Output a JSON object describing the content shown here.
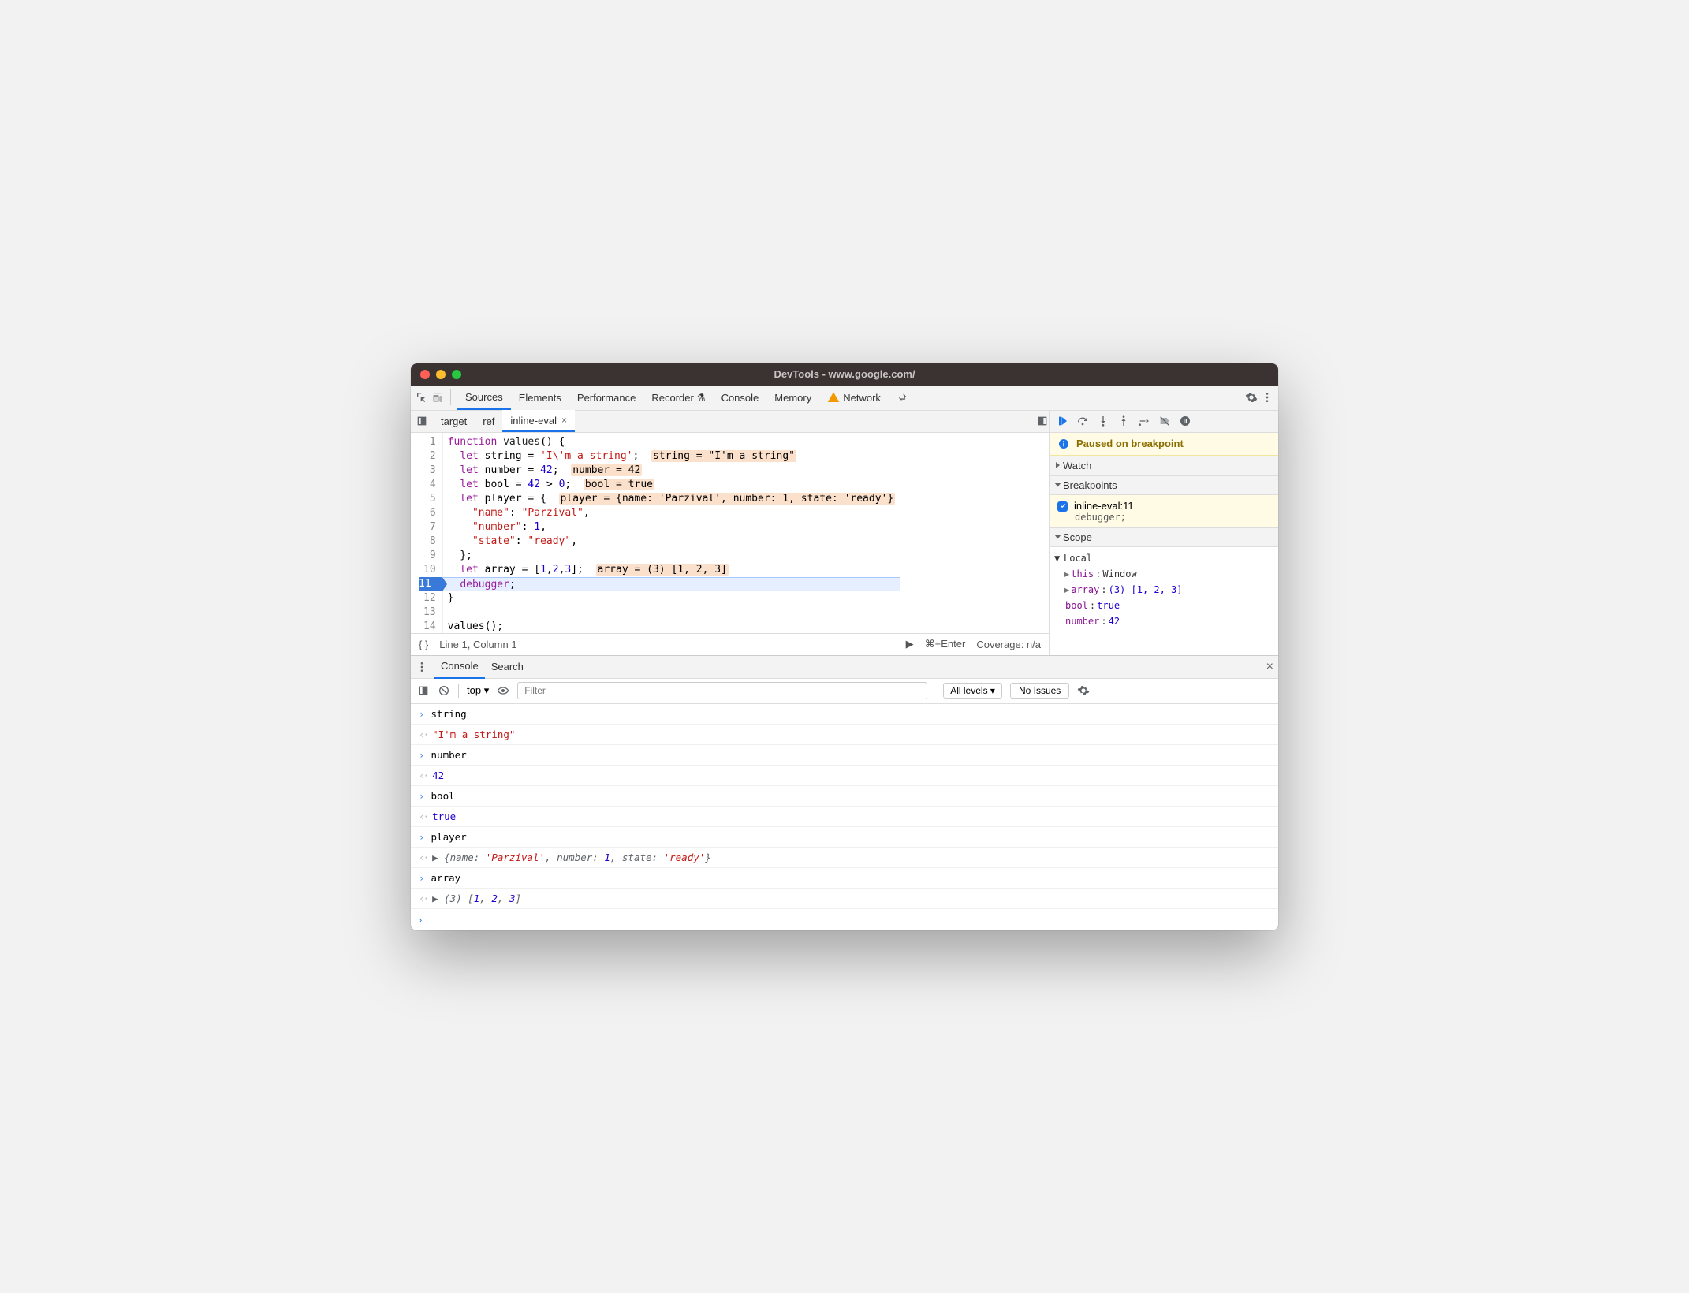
{
  "window": {
    "title": "DevTools - www.google.com/"
  },
  "tabs": {
    "items": [
      "Sources",
      "Elements",
      "Performance",
      "Recorder",
      "Console",
      "Memory",
      "Network"
    ],
    "activeIndex": 0,
    "networkWarning": true
  },
  "fileTabs": {
    "items": [
      "target",
      "ref",
      "inline-eval"
    ],
    "activeIndex": 2
  },
  "code": {
    "lines": [
      {
        "n": 1,
        "segs": [
          {
            "t": "function ",
            "c": "kw"
          },
          {
            "t": "values",
            "c": "fn"
          },
          {
            "t": "() {"
          }
        ]
      },
      {
        "n": 2,
        "segs": [
          {
            "t": "  "
          },
          {
            "t": "let ",
            "c": "kw"
          },
          {
            "t": "string = "
          },
          {
            "t": "'I\\'m a string'",
            "c": "str"
          },
          {
            "t": ";  "
          },
          {
            "t": "string = \"I'm a string\"",
            "c": "hl"
          }
        ]
      },
      {
        "n": 3,
        "segs": [
          {
            "t": "  "
          },
          {
            "t": "let ",
            "c": "kw"
          },
          {
            "t": "number = "
          },
          {
            "t": "42",
            "c": "num"
          },
          {
            "t": ";  "
          },
          {
            "t": "number = 42",
            "c": "hl"
          }
        ]
      },
      {
        "n": 4,
        "segs": [
          {
            "t": "  "
          },
          {
            "t": "let ",
            "c": "kw"
          },
          {
            "t": "bool = "
          },
          {
            "t": "42",
            "c": "num"
          },
          {
            "t": " > "
          },
          {
            "t": "0",
            "c": "num"
          },
          {
            "t": ";  "
          },
          {
            "t": "bool = true",
            "c": "hl"
          }
        ]
      },
      {
        "n": 5,
        "segs": [
          {
            "t": "  "
          },
          {
            "t": "let ",
            "c": "kw"
          },
          {
            "t": "player = {  "
          },
          {
            "t": "player = {name: 'Parzival', number: 1, state: 'ready'}",
            "c": "hl"
          }
        ]
      },
      {
        "n": 6,
        "segs": [
          {
            "t": "    "
          },
          {
            "t": "\"name\"",
            "c": "prop"
          },
          {
            "t": ": "
          },
          {
            "t": "\"Parzival\"",
            "c": "str"
          },
          {
            "t": ","
          }
        ]
      },
      {
        "n": 7,
        "segs": [
          {
            "t": "    "
          },
          {
            "t": "\"number\"",
            "c": "prop"
          },
          {
            "t": ": "
          },
          {
            "t": "1",
            "c": "num"
          },
          {
            "t": ","
          }
        ]
      },
      {
        "n": 8,
        "segs": [
          {
            "t": "    "
          },
          {
            "t": "\"state\"",
            "c": "prop"
          },
          {
            "t": ": "
          },
          {
            "t": "\"ready\"",
            "c": "str"
          },
          {
            "t": ","
          }
        ]
      },
      {
        "n": 9,
        "segs": [
          {
            "t": "  };"
          }
        ]
      },
      {
        "n": 10,
        "segs": [
          {
            "t": "  "
          },
          {
            "t": "let ",
            "c": "kw"
          },
          {
            "t": "array = ["
          },
          {
            "t": "1",
            "c": "num"
          },
          {
            "t": ","
          },
          {
            "t": "2",
            "c": "num"
          },
          {
            "t": ","
          },
          {
            "t": "3",
            "c": "num"
          },
          {
            "t": "];  "
          },
          {
            "t": "array = (3) [1, 2, 3]",
            "c": "hl"
          }
        ]
      },
      {
        "n": 11,
        "bp": true,
        "cur": true,
        "segs": [
          {
            "t": "  "
          },
          {
            "t": "debugger",
            "c": "kw"
          },
          {
            "t": ";"
          }
        ]
      },
      {
        "n": 12,
        "segs": [
          {
            "t": "}"
          }
        ]
      },
      {
        "n": 13,
        "segs": [
          {
            "t": ""
          }
        ]
      },
      {
        "n": 14,
        "segs": [
          {
            "t": "values();"
          }
        ]
      }
    ]
  },
  "status": {
    "cursor": "Line 1, Column 1",
    "runHint": "⌘+Enter",
    "coverage": "Coverage: n/a"
  },
  "debugger": {
    "banner": "Paused on breakpoint",
    "sections": {
      "watch": "Watch",
      "breakpoints": "Breakpoints",
      "scope": "Scope"
    },
    "breakpoint": {
      "label": "inline-eval:11",
      "code": "debugger;"
    },
    "scope": {
      "local": "Local",
      "rows": [
        {
          "pre": "▶ ",
          "k": "this",
          "v": "Window",
          "vc": ""
        },
        {
          "pre": "▶ ",
          "k": "array",
          "v": "(3) [1, 2, 3]",
          "vc": "v"
        },
        {
          "pre": "  ",
          "k": "bool",
          "v": "true",
          "vc": "v"
        },
        {
          "pre": "  ",
          "k": "number",
          "v": "42",
          "vc": "v"
        }
      ]
    }
  },
  "drawer": {
    "tabs": [
      "Console",
      "Search"
    ],
    "activeIndex": 0,
    "filterPlaceholder": "Filter",
    "context": "top",
    "levels": "All levels",
    "issues": "No Issues"
  },
  "console": {
    "entries": [
      {
        "kind": "in",
        "text": "string"
      },
      {
        "kind": "out",
        "cls": "strv",
        "text": "\"I'm a string\""
      },
      {
        "kind": "in",
        "text": "number"
      },
      {
        "kind": "out",
        "cls": "numv",
        "text": "42"
      },
      {
        "kind": "in",
        "text": "bool"
      },
      {
        "kind": "out",
        "cls": "boolv",
        "text": "true"
      },
      {
        "kind": "in",
        "text": "player"
      },
      {
        "kind": "out",
        "cls": "obj",
        "html": "▶ {name: <span class='sv'>'Parzival'</span>, number: <span class='nv'>1</span>, state: <span class='sv'>'ready'</span>}"
      },
      {
        "kind": "in",
        "text": "array"
      },
      {
        "kind": "out",
        "cls": "obj",
        "html": "▶ (3) [<span class='nv'>1</span>, <span class='nv'>2</span>, <span class='nv'>3</span>]"
      }
    ]
  }
}
